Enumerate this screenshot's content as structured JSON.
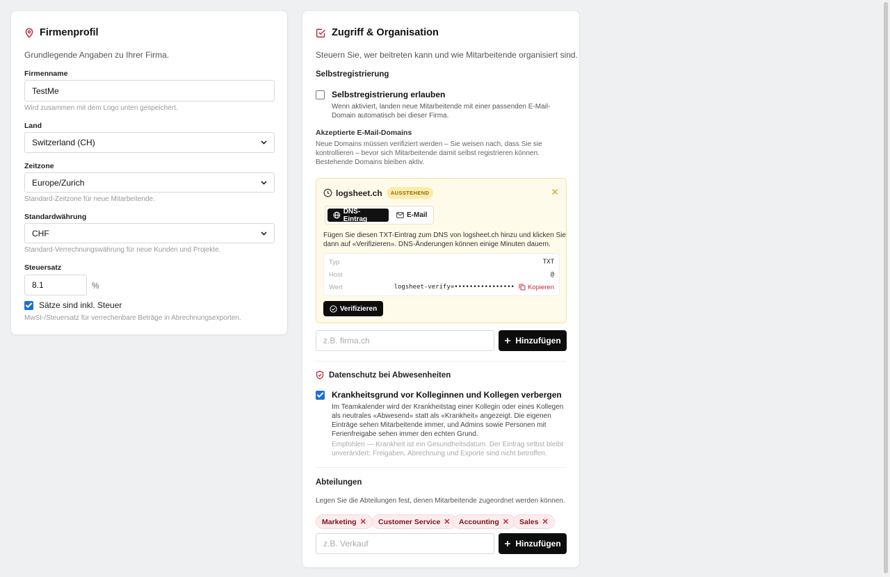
{
  "profile": {
    "title": "Firmenprofil",
    "subtitle": "Grundlegende Angaben zu Ihrer Firma.",
    "company_name_label": "Firmenname",
    "company_name_value": "TestMe",
    "company_name_hint": "Wird zusammen mit dem Logo unten gespeichert.",
    "country_label": "Land",
    "country_value": "Switzerland (CH)",
    "timezone_label": "Zeitzone",
    "timezone_value": "Europe/Zurich",
    "timezone_hint": "Standard-Zeitzone für neue Mitarbeitende.",
    "currency_label": "Standardwährung",
    "currency_value": "CHF",
    "currency_hint": "Standard-Verrechnungswährung für neue Kunden und Projekte.",
    "tax_label": "Steuersatz",
    "tax_value": "8.1",
    "tax_unit": "%",
    "tax_incl_label": "Sätze sind inkl. Steuer",
    "tax_incl_checked": true,
    "tax_hint": "MwSt-/Steuersatz für verrechenbare Beträge in Abrechnungsexporten."
  },
  "access": {
    "title": "Zugriff & Organisation",
    "subtitle": "Steuern Sie, wer beitreten kann und wie Mitarbeitende organisiert sind.",
    "selfreg_heading": "Selbstregistrierung",
    "selfreg_label": "Selbstregistrierung erlauben",
    "selfreg_checked": false,
    "selfreg_desc_1": "Wenn aktiviert, landen neue Mitarbeitende mit einer passenden E-Mail-",
    "selfreg_desc_2": "Domain automatisch bei dieser Firma.",
    "domains_heading": "Akzeptierte E-Mail-Domains",
    "domains_desc_1": "Neue Domains müssen verifiziert werden – Sie weisen nach, dass Sie sie",
    "domains_desc_2": "kontrollieren – bevor sich Mitarbeitende damit selbst registrieren können.",
    "domains_desc_3": "Bestehende Domains bleiben aktiv.",
    "pending_domain": {
      "name": "logsheet.ch",
      "badge": "AUSSTEHEND",
      "tab_dns": "DNS-Eintrag",
      "tab_email": "E-Mail",
      "instructions_1": "Fügen Sie diesen TXT-Eintrag zum DNS von logsheet.ch hinzu und klicken Sie",
      "instructions_2": "dann auf «Verifizieren». DNS-Änderungen können einige Minuten dauern.",
      "type_key": "Typ",
      "type_val": "TXT",
      "host_key": "Host",
      "host_val": "@",
      "value_key": "Wert",
      "value_val": "logsheet-verify=••••••••••••••••",
      "copy_label": "Kopieren",
      "verify_label": "Verifizieren"
    },
    "domain_input_placeholder": "z.B. firma.ch",
    "add_label": "Hinzufügen",
    "privacy_heading": "Datenschutz bei Abwesenheiten",
    "privacy_label": "Krankheitsgrund vor Kolleginnen und Kollegen verbergen",
    "privacy_checked": true,
    "privacy_desc_1": "Im Teamkalender wird der Krankheitstag einer Kollegin oder eines Kollegen",
    "privacy_desc_2": "als neutrales «Abwesend» statt als «Krankheit» angezeigt. Die eigenen",
    "privacy_desc_3": "Einträge sehen Mitarbeitende immer, und Admins sowie Personen mit",
    "privacy_desc_4": "Ferienfreigabe sehen immer den echten Grund.",
    "privacy_note_1": "Empfohlen — Krankheit ist ein Gesundheitsdatum. Der Eintrag selbst bleibt",
    "privacy_note_2": "unverändert: Freigaben, Abrechnung und Exporte sind nicht betroffen.",
    "departments_heading": "Abteilungen",
    "departments_desc": "Legen Sie die Abteilungen fest, denen Mitarbeitende zugeordnet werden können.",
    "departments": [
      "Marketing",
      "Customer Service",
      "Accounting",
      "Sales"
    ],
    "department_input_placeholder": "z.B. Verkauf"
  },
  "colors": {
    "accent_red": "#c0283a",
    "primary_black": "#0d0d0d",
    "checkbox_blue": "#1a6fd9"
  }
}
